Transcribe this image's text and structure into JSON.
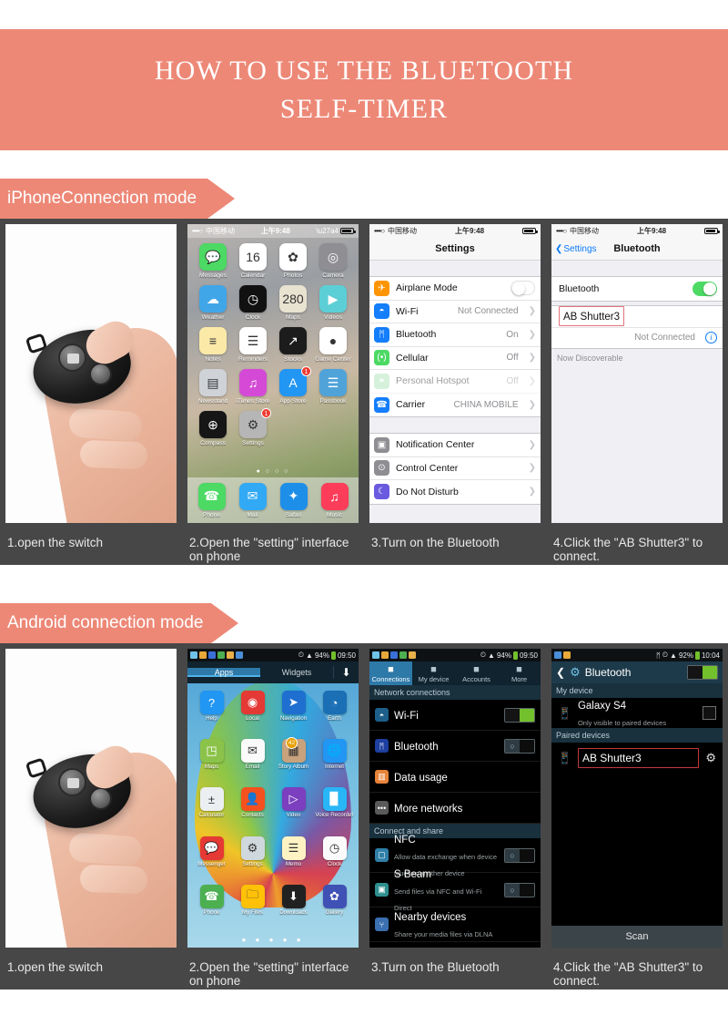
{
  "title": {
    "line1": "HOW TO USE THE BLUETOOTH",
    "line2": "SELF-TIMER"
  },
  "colors": {
    "accent": "#ed8877",
    "panel_bg": "#474747",
    "ios_green": "#4cd964",
    "highlight_box": "#e2727c"
  },
  "sections": [
    {
      "tag": "iPhoneConnection mode"
    },
    {
      "tag": "Android connection mode"
    }
  ],
  "captions": [
    "1.open the switch",
    "2.Open the \"setting\" interface on phone",
    "3.Turn on the Bluetooth",
    "4.Click the \"AB Shutter3\" to connect."
  ],
  "ios": {
    "status": {
      "dots": "••••○",
      "carrier": "中国移动",
      "time": "上午9:48"
    },
    "home": {
      "apps": [
        {
          "label": "Messages",
          "icon": "messages-icon",
          "color": "#4cd964",
          "glyph": "💬"
        },
        {
          "label": "Calendar",
          "icon": "calendar-icon",
          "color": "#ffffff",
          "glyph": "16"
        },
        {
          "label": "Photos",
          "icon": "photos-icon",
          "color": "#ffffff",
          "glyph": "✿"
        },
        {
          "label": "Camera",
          "icon": "camera-icon",
          "color": "#8e8e93",
          "glyph": "◎"
        },
        {
          "label": "Weather",
          "icon": "weather-icon",
          "color": "#41a6e8",
          "glyph": "☁"
        },
        {
          "label": "Clock",
          "icon": "clock-icon",
          "color": "#111111",
          "glyph": "◷"
        },
        {
          "label": "Maps",
          "icon": "maps-icon",
          "color": "#e8e2d0",
          "glyph": "280"
        },
        {
          "label": "Videos",
          "icon": "videos-icon",
          "color": "#5ccfd6",
          "glyph": "▶"
        },
        {
          "label": "Notes",
          "icon": "notes-icon",
          "color": "#fbe9a8",
          "glyph": "≡"
        },
        {
          "label": "Reminders",
          "icon": "reminders-icon",
          "color": "#ffffff",
          "glyph": "☰"
        },
        {
          "label": "Stocks",
          "icon": "stocks-icon",
          "color": "#1c1c1c",
          "glyph": "↗"
        },
        {
          "label": "Game Center",
          "icon": "game-center-icon",
          "color": "#ffffff",
          "glyph": "●"
        },
        {
          "label": "Newsstand",
          "icon": "newsstand-icon",
          "color": "#cfd3d8",
          "glyph": "▤"
        },
        {
          "label": "iTunes Store",
          "icon": "itunes-store-icon",
          "color": "#d44ad6",
          "glyph": "♫"
        },
        {
          "label": "App Store",
          "icon": "app-store-icon",
          "color": "#2196f3",
          "glyph": "A",
          "badge": "1"
        },
        {
          "label": "Passbook",
          "icon": "passbook-icon",
          "color": "#4fa3d9",
          "glyph": "☰"
        },
        {
          "label": "Compass",
          "icon": "compass-icon",
          "color": "#161616",
          "glyph": "⊕"
        },
        {
          "label": "Settings",
          "icon": "settings-icon",
          "color": "#b6b6b6",
          "glyph": "⚙",
          "badge": "1"
        }
      ],
      "dock": [
        {
          "label": "Phone",
          "icon": "phone-icon",
          "color": "#4cd964",
          "glyph": "☎"
        },
        {
          "label": "Mail",
          "icon": "mail-icon",
          "color": "#31a9f5",
          "glyph": "✉"
        },
        {
          "label": "Safari",
          "icon": "safari-icon",
          "color": "#1e8fe8",
          "glyph": "✦"
        },
        {
          "label": "Music",
          "icon": "music-icon",
          "color": "#fc3d5a",
          "glyph": "♫"
        }
      ],
      "page_dots": "● ○ ○ ○"
    },
    "settings": {
      "nav_title": "Settings",
      "rows_group1": [
        {
          "label": "Airplane Mode",
          "icon": "airplane-icon",
          "color": "#ff9500",
          "glyph": "✈",
          "control": "toggle-off"
        },
        {
          "label": "Wi-Fi",
          "icon": "wifi-icon",
          "color": "#147efb",
          "glyph": "◓",
          "value": "Not Connected",
          "control": "chevron"
        },
        {
          "label": "Bluetooth",
          "icon": "bluetooth-icon",
          "color": "#147efb",
          "glyph": "ᛗ",
          "value": "On",
          "control": "chevron"
        },
        {
          "label": "Cellular",
          "icon": "cellular-icon",
          "color": "#4cd964",
          "glyph": "(•)",
          "value": "Off",
          "control": "chevron"
        },
        {
          "label": "Personal Hotspot",
          "icon": "hotspot-icon",
          "color": "#9fe0ab",
          "glyph": "⚭",
          "value": "Off",
          "control": "chevron",
          "dim": true
        },
        {
          "label": "Carrier",
          "icon": "carrier-icon",
          "color": "#147efb",
          "glyph": "☎",
          "value": "CHINA MOBILE",
          "control": "chevron"
        }
      ],
      "rows_group2": [
        {
          "label": "Notification Center",
          "icon": "notification-center-icon",
          "color": "#8e8e93",
          "glyph": "▣",
          "control": "chevron"
        },
        {
          "label": "Control Center",
          "icon": "control-center-icon",
          "color": "#8e8e93",
          "glyph": "⊙",
          "control": "chevron"
        },
        {
          "label": "Do Not Disturb",
          "icon": "do-not-disturb-icon",
          "color": "#6a5ae0",
          "glyph": "☾",
          "control": "chevron"
        }
      ]
    },
    "bluetooth": {
      "back_label": "Settings",
      "nav_title": "Bluetooth",
      "toggle_row_label": "Bluetooth",
      "toggle_state": "on",
      "device_name": "AB Shutter3",
      "device_status": "Not Connected",
      "discoverable_note": "Now Discoverable"
    }
  },
  "android": {
    "home": {
      "status_time": "09:50",
      "battery": "94%",
      "tabs": [
        "Apps",
        "Widgets"
      ],
      "download_icon": "download-icon",
      "apps": [
        {
          "label": "Help",
          "icon": "help-icon",
          "color": "#2196f3",
          "glyph": "?"
        },
        {
          "label": "Local",
          "icon": "local-icon",
          "color": "#e53935",
          "glyph": "◉"
        },
        {
          "label": "Navigation",
          "icon": "navigation-icon",
          "color": "#1f6fd0",
          "glyph": "➤"
        },
        {
          "label": "Earth",
          "icon": "earth-icon",
          "color": "#1a6fb5",
          "glyph": "◔"
        },
        {
          "label": "Maps",
          "icon": "maps-icon",
          "color": "#8bc34a",
          "glyph": "◳"
        },
        {
          "label": "Email",
          "icon": "email-icon",
          "color": "#fafafa",
          "glyph": "✉"
        },
        {
          "label": "Story Album",
          "icon": "story-album-icon",
          "color": "#c8a27c",
          "glyph": "▦",
          "badge": "42"
        },
        {
          "label": "Internet",
          "icon": "internet-icon",
          "color": "#2196f3",
          "glyph": "🌐"
        },
        {
          "label": "Calculator",
          "icon": "calculator-icon",
          "color": "#eceff1",
          "glyph": "±"
        },
        {
          "label": "Contacts",
          "icon": "contacts-icon",
          "color": "#f4511e",
          "glyph": "👤"
        },
        {
          "label": "Video",
          "icon": "video-icon",
          "color": "#7b3fbf",
          "glyph": "▷"
        },
        {
          "label": "Voice Recorder",
          "icon": "voice-recorder-icon",
          "color": "#29b6f6",
          "glyph": "▉"
        },
        {
          "label": "Messenger",
          "icon": "messenger-icon",
          "color": "#e53935",
          "glyph": "💬"
        },
        {
          "label": "Settings",
          "icon": "settings-icon",
          "color": "#cfd8dc",
          "glyph": "⚙"
        },
        {
          "label": "Memo",
          "icon": "memo-icon",
          "color": "#fff3c4",
          "glyph": "☰"
        },
        {
          "label": "Clock",
          "icon": "clock-icon",
          "color": "#fafafa",
          "glyph": "◷"
        },
        {
          "label": "Phone",
          "icon": "phone-icon",
          "color": "#4caf50",
          "glyph": "☎"
        },
        {
          "label": "My Files",
          "icon": "my-files-icon",
          "color": "#ffc107",
          "glyph": "🗀"
        },
        {
          "label": "Downloads",
          "icon": "downloads-icon",
          "color": "#212121",
          "glyph": "⬇"
        },
        {
          "label": "Gallery",
          "icon": "gallery-icon",
          "color": "#3f51b5",
          "glyph": "✿"
        }
      ],
      "page_dots": "● ● ● ● ●"
    },
    "settings": {
      "status_time": "09:50",
      "battery": "94%",
      "tabs": [
        {
          "label": "Connections",
          "icon": "connections-icon",
          "active": true
        },
        {
          "label": "My device",
          "icon": "my-device-icon",
          "active": false
        },
        {
          "label": "Accounts",
          "icon": "accounts-icon",
          "active": false
        },
        {
          "label": "More",
          "icon": "more-icon",
          "active": false
        }
      ],
      "section1": "Network connections",
      "rows1": [
        {
          "label": "Wi-Fi",
          "icon": "wifi-icon",
          "color": "#1d5f8a",
          "glyph": "◓",
          "switch": "on"
        },
        {
          "label": "Bluetooth",
          "icon": "bluetooth-icon",
          "color": "#1d3fa0",
          "glyph": "ᛗ",
          "switch": "off"
        },
        {
          "label": "Data usage",
          "icon": "data-usage-icon",
          "color": "#e8833a",
          "glyph": "▥",
          "switch": "none"
        },
        {
          "label": "More networks",
          "icon": "more-networks-icon",
          "color": "#5a5a5a",
          "glyph": "•••",
          "switch": "none"
        }
      ],
      "section2": "Connect and share",
      "rows2": [
        {
          "label": "NFC",
          "sub": "Allow data exchange when device touches another device",
          "icon": "nfc-icon",
          "color": "#2f7fa8",
          "glyph": "▢",
          "switch": "off"
        },
        {
          "label": "S Beam",
          "sub": "Send files via NFC and Wi-Fi Direct",
          "icon": "s-beam-icon",
          "color": "#2f8f8f",
          "glyph": "▣",
          "switch": "off"
        },
        {
          "label": "Nearby devices",
          "sub": "Share your media files via DLNA",
          "icon": "nearby-devices-icon",
          "color": "#3a6fb0",
          "glyph": "⑂",
          "switch": "none"
        }
      ]
    },
    "bluetooth": {
      "status_time": "10:04",
      "battery": "92%",
      "nav_title": "Bluetooth",
      "toggle_state": "on",
      "section_my_device": "My device",
      "my_device_name": "Galaxy S4",
      "my_device_sub": "Only visible to paired devices",
      "section_paired": "Paired devices",
      "paired_device": "AB Shutter3",
      "settings_icon": "gear-icon",
      "scan_label": "Scan"
    }
  }
}
